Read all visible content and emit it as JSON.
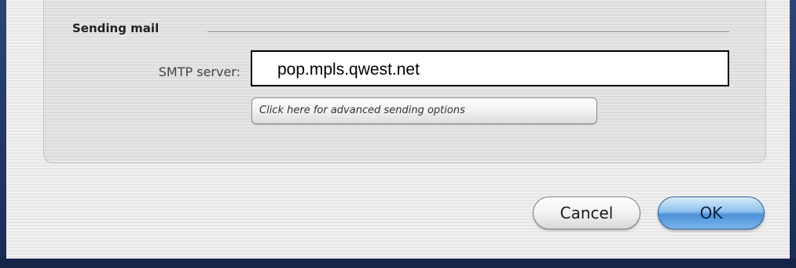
{
  "sending_mail": {
    "section_title": "Sending mail",
    "smtp_label": "SMTP server:",
    "smtp_value": "pop.mpls.qwest.net",
    "advanced_button_label": "Click here for advanced sending options"
  },
  "footer": {
    "cancel_label": "Cancel",
    "ok_label": "OK"
  },
  "colors": {
    "default_button": "#6aa8e4",
    "dialog_background": "#ececec",
    "desktop_background": "#1c2e5c"
  }
}
